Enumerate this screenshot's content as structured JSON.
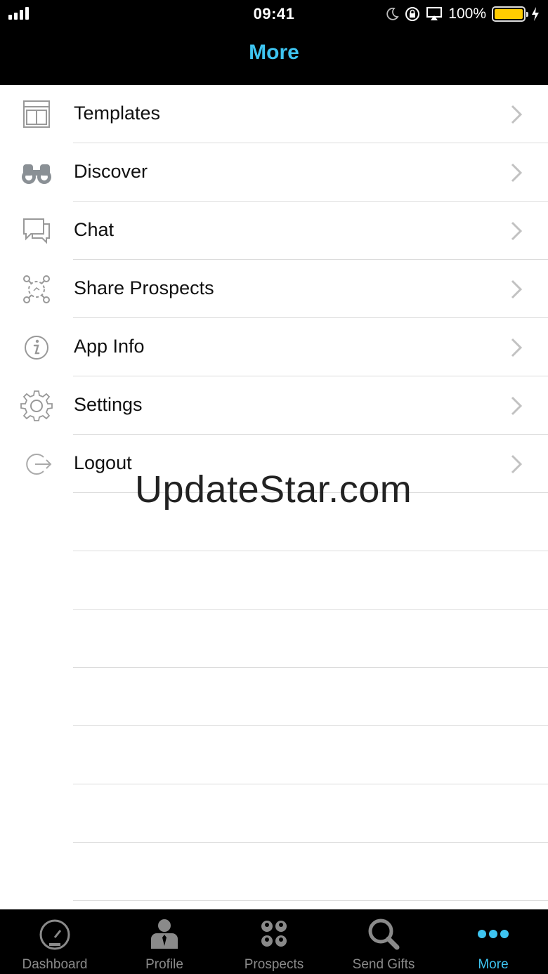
{
  "status_bar": {
    "time": "09:41",
    "battery_pct": "100%"
  },
  "nav": {
    "title": "More"
  },
  "menu": [
    {
      "label": "Templates",
      "icon": "templates-icon"
    },
    {
      "label": "Discover",
      "icon": "binoculars-icon"
    },
    {
      "label": "Chat",
      "icon": "chat-bubbles-icon"
    },
    {
      "label": "Share Prospects",
      "icon": "share-network-icon"
    },
    {
      "label": "App Info",
      "icon": "info-icon"
    },
    {
      "label": "Settings",
      "icon": "gear-icon"
    },
    {
      "label": "Logout",
      "icon": "logout-icon"
    }
  ],
  "watermark": "UpdateStar.com",
  "tabs": [
    {
      "label": "Dashboard",
      "icon": "speedometer-icon"
    },
    {
      "label": "Profile",
      "icon": "person-icon"
    },
    {
      "label": "Prospects",
      "icon": "people-icon"
    },
    {
      "label": "Send Gifts",
      "icon": "search-icon"
    },
    {
      "label": "More",
      "icon": "more-dots-icon",
      "active": true
    }
  ],
  "colors": {
    "accent": "#3ec4f0",
    "battery": "#ffcc00",
    "icon_gray": "#8a8a8a"
  }
}
